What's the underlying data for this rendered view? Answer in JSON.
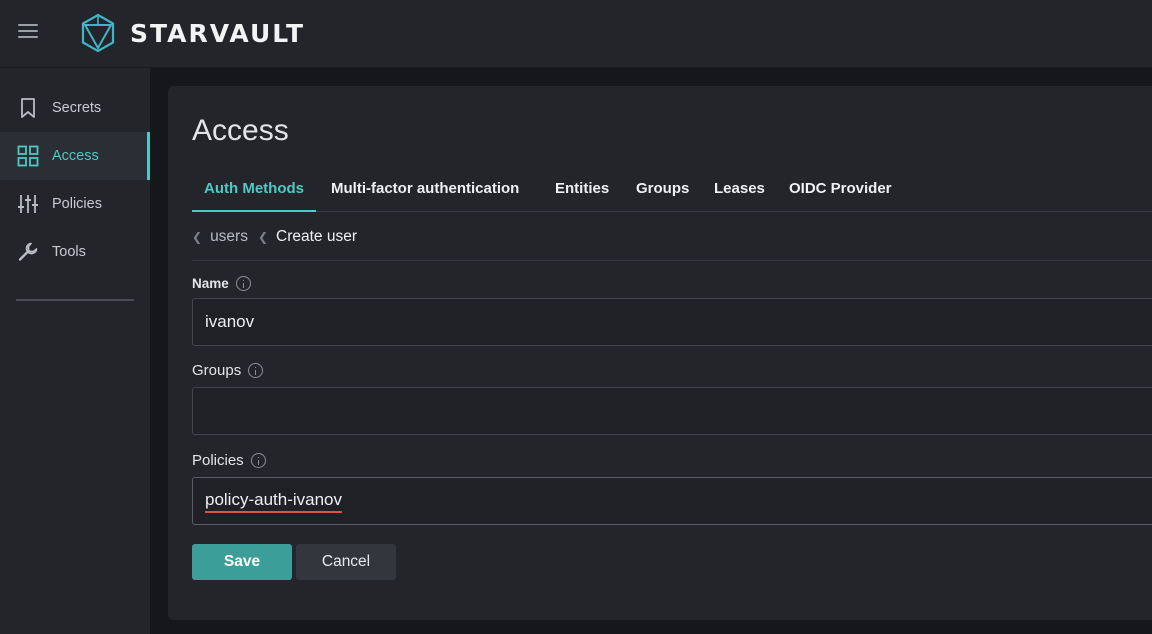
{
  "app": {
    "brand": "STARVAULT"
  },
  "sidebar": {
    "items": [
      {
        "label": "Secrets",
        "icon": "bookmark-icon"
      },
      {
        "label": "Access",
        "icon": "grid-icon",
        "active": true
      },
      {
        "label": "Policies",
        "icon": "sliders-icon"
      },
      {
        "label": "Tools",
        "icon": "wrench-icon"
      }
    ]
  },
  "main": {
    "title": "Access",
    "tabs": [
      {
        "label": "Auth Methods",
        "active": true
      },
      {
        "label": "Multi-factor authentication"
      },
      {
        "label": "Entities"
      },
      {
        "label": "Groups"
      },
      {
        "label": "Leases"
      },
      {
        "label": "OIDC Provider"
      }
    ],
    "breadcrumb": {
      "parent": "users",
      "current": "Create user"
    },
    "form": {
      "name_label": "Name",
      "name_value": "ivanov",
      "groups_label": "Groups",
      "groups_value": "",
      "policies_label": "Policies",
      "policies_value": "policy-auth-ivanov"
    },
    "buttons": {
      "save": "Save",
      "cancel": "Cancel"
    }
  },
  "colors": {
    "accent": "#4fc9c4",
    "save_button": "#3c9e98",
    "spellcheck": "#e0504f"
  }
}
